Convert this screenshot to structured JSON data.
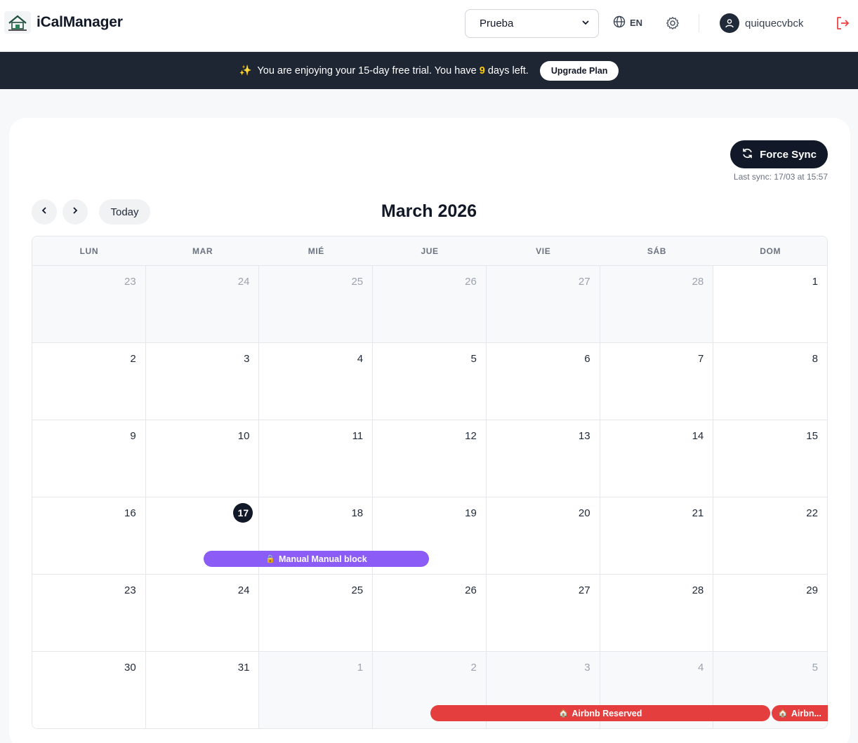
{
  "header": {
    "app_title": "iCalManager",
    "property_select": "Prueba",
    "language": "EN",
    "username": "quiquecvbck"
  },
  "banner": {
    "text_before": "You are enjoying your 15-day free trial. You have",
    "days_left": "9",
    "text_after": "days left.",
    "upgrade_label": "Upgrade Plan"
  },
  "toolbar": {
    "force_sync_label": "Force Sync",
    "last_sync": "Last sync: 17/03 at 15:57",
    "today_label": "Today",
    "month_title": "March 2026"
  },
  "calendar": {
    "weekdays": [
      "LUN",
      "MAR",
      "MIÉ",
      "JUE",
      "VIE",
      "SÁB",
      "DOM"
    ],
    "weeks": [
      [
        {
          "d": "23",
          "o": true
        },
        {
          "d": "24",
          "o": true
        },
        {
          "d": "25",
          "o": true
        },
        {
          "d": "26",
          "o": true
        },
        {
          "d": "27",
          "o": true
        },
        {
          "d": "28",
          "o": true
        },
        {
          "d": "1"
        }
      ],
      [
        {
          "d": "2"
        },
        {
          "d": "3"
        },
        {
          "d": "4"
        },
        {
          "d": "5"
        },
        {
          "d": "6"
        },
        {
          "d": "7"
        },
        {
          "d": "8"
        }
      ],
      [
        {
          "d": "9"
        },
        {
          "d": "10"
        },
        {
          "d": "11"
        },
        {
          "d": "12"
        },
        {
          "d": "13"
        },
        {
          "d": "14"
        },
        {
          "d": "15"
        }
      ],
      [
        {
          "d": "16"
        },
        {
          "d": "17",
          "today": true
        },
        {
          "d": "18"
        },
        {
          "d": "19"
        },
        {
          "d": "20"
        },
        {
          "d": "21"
        },
        {
          "d": "22"
        }
      ],
      [
        {
          "d": "23"
        },
        {
          "d": "24"
        },
        {
          "d": "25"
        },
        {
          "d": "26"
        },
        {
          "d": "27"
        },
        {
          "d": "28"
        },
        {
          "d": "29"
        }
      ],
      [
        {
          "d": "30"
        },
        {
          "d": "31"
        },
        {
          "d": "1",
          "o": true
        },
        {
          "d": "2",
          "o": true
        },
        {
          "d": "3",
          "o": true
        },
        {
          "d": "4",
          "o": true
        },
        {
          "d": "5",
          "o": true
        }
      ]
    ]
  },
  "events": {
    "manual_block": "Manual Manual block",
    "airbnb_reserved": "Airbnb Reserved",
    "airbnb_truncated": "Airbn..."
  },
  "colors": {
    "banner_bg": "#1e2533",
    "trial_days": "#facc15",
    "manual_event": "#8b5cf6",
    "airbnb_event": "#e53e3e",
    "logout_icon": "#ef4444"
  },
  "icons": [
    "logo-icon",
    "chevron-down-icon",
    "globe-icon",
    "gear-icon",
    "user-icon",
    "logout-icon",
    "sparkle-icon",
    "sync-icon",
    "chevron-left-icon",
    "chevron-right-icon",
    "lock-icon",
    "house-icon"
  ]
}
